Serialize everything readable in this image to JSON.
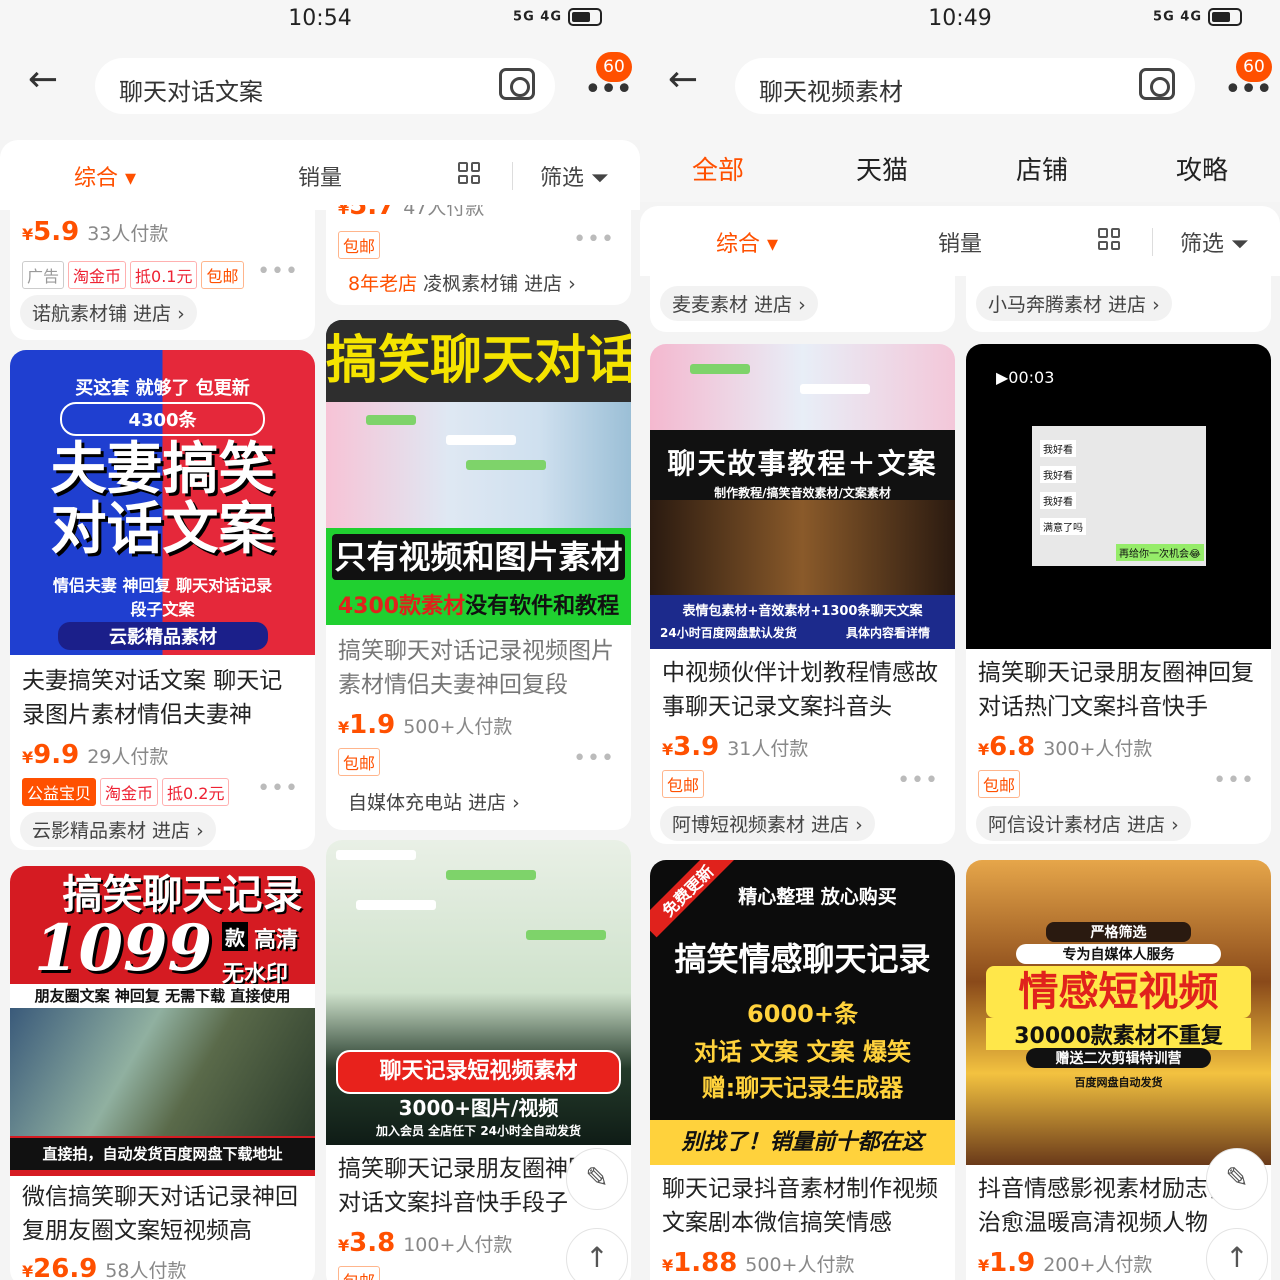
{
  "left": {
    "status": {
      "time": "10:54",
      "net": "5G 4G"
    },
    "search_query": "聊天对话文案",
    "badge": "60",
    "sort": {
      "comprehensive": "综合",
      "sales": "销量",
      "filter": "筛选"
    },
    "items": {
      "a": {
        "price": "5.9",
        "paid": "33人付款",
        "tags": [
          "广告",
          "淘金币",
          "抵0.1元",
          "包邮"
        ],
        "store": "诺航素材铺 进店"
      },
      "b": {
        "price": "5.7",
        "paid": "47人付款",
        "tags": [
          "包邮"
        ],
        "store_prefix": "8年老店",
        "store": "凌枫素材铺 进店"
      },
      "c": {
        "thumb_lines": [
          "买这套 就够了 包更新",
          "4300条",
          "夫妻搞笑",
          "对话文案",
          "情侣夫妻 神回复 聊天对话记录",
          "段子文案",
          "云影精品素材"
        ],
        "title": "夫妻搞笑对话文案 聊天记录图片素材情侣夫妻神",
        "price": "9.9",
        "paid": "29人付款",
        "tags": [
          "公益宝贝",
          "淘金币",
          "抵0.2元"
        ],
        "store": "云影精品素材 进店"
      },
      "d": {
        "thumb_lines": [
          "搞笑聊天对话",
          "只有视频和图片素材",
          "4300款素材",
          "没有软件和教程"
        ],
        "title": "搞笑聊天对话记录视频图片素材情侣夫妻神回复段",
        "price": "1.9",
        "paid": "500+人付款",
        "tags": [
          "包邮"
        ],
        "store": "自媒体充电站 进店"
      },
      "e": {
        "thumb_lines": [
          "搞笑聊天记录",
          "1099",
          "款",
          "高清",
          "无水印",
          "朋友圈文案 神回复 无需下载 直接使用",
          "直接拍，自动发货百度网盘下载地址"
        ],
        "title": "微信搞笑聊天对话记录神回复朋友圈文案短视频高",
        "price": "26.9",
        "paid": "58人付款"
      },
      "f": {
        "thumb_lines": [
          "聊天记录短视频素材",
          "3000+图片/视频",
          "加入会员 全店任下 24小时全自动发货"
        ],
        "title": "搞笑聊天记录朋友圈神回复对话文案抖音快手段子",
        "price": "3.8",
        "paid": "100+人付款",
        "tags": [
          "包邮"
        ]
      }
    }
  },
  "right": {
    "status": {
      "time": "10:49",
      "net": "5G 4G"
    },
    "search_query": "聊天视频素材",
    "badge": "60",
    "tabs": [
      "全部",
      "天猫",
      "店铺",
      "攻略"
    ],
    "sort": {
      "comprehensive": "综合",
      "sales": "销量",
      "filter": "筛选"
    },
    "items": {
      "a": {
        "store": "麦麦素材 进店"
      },
      "b": {
        "store": "小马奔腾素材 进店"
      },
      "c": {
        "thumb_lines": [
          "聊天故事教程＋文案",
          "制作教程/搞笑音效素材/文案素材",
          "表情包素材+音效素材+1300条聊天文案",
          "24小时百度网盘默认发货",
          "具体内容看详情"
        ],
        "title": "中视频伙伴计划教程情感故事聊天记录文案抖音头",
        "price": "3.9",
        "paid": "31人付款",
        "tags": [
          "包邮"
        ],
        "store": "阿博短视频素材 进店"
      },
      "d": {
        "thumb_lines": [
          "▶00:03",
          "我好看",
          "我好看",
          "我好看",
          "满意了吗",
          "再给你一次机会😂"
        ],
        "title": "搞笑聊天记录朋友圈神回复对话热门文案抖音快手",
        "price": "6.8",
        "paid": "300+人付款",
        "tags": [
          "包邮"
        ],
        "store": "阿信设计素材店 进店"
      },
      "e": {
        "thumb_lines": [
          "免费更新",
          "精心整理 放心购买",
          "搞笑情感聊天记录",
          "6000+条",
          "对话 文案 文案 爆笑",
          "赠:聊天记录生成器",
          "别找了！销量前十都在这"
        ],
        "title": "聊天记录抖音素材制作视频文案剧本微信搞笑情感",
        "price": "1.88",
        "paid": "500+人付款"
      },
      "f": {
        "thumb_lines": [
          "严格筛选",
          "专为自媒体人服务",
          "情感短视频",
          "30000款素材不重复",
          "赠送二次剪辑特训营",
          "百度网盘自动发货"
        ],
        "title": "抖音情感影视素材励志情感治愈温暖高清视频人物",
        "price": "1.9",
        "paid": "200+人付款"
      }
    }
  },
  "colors": {
    "accent": "#ff5000"
  }
}
